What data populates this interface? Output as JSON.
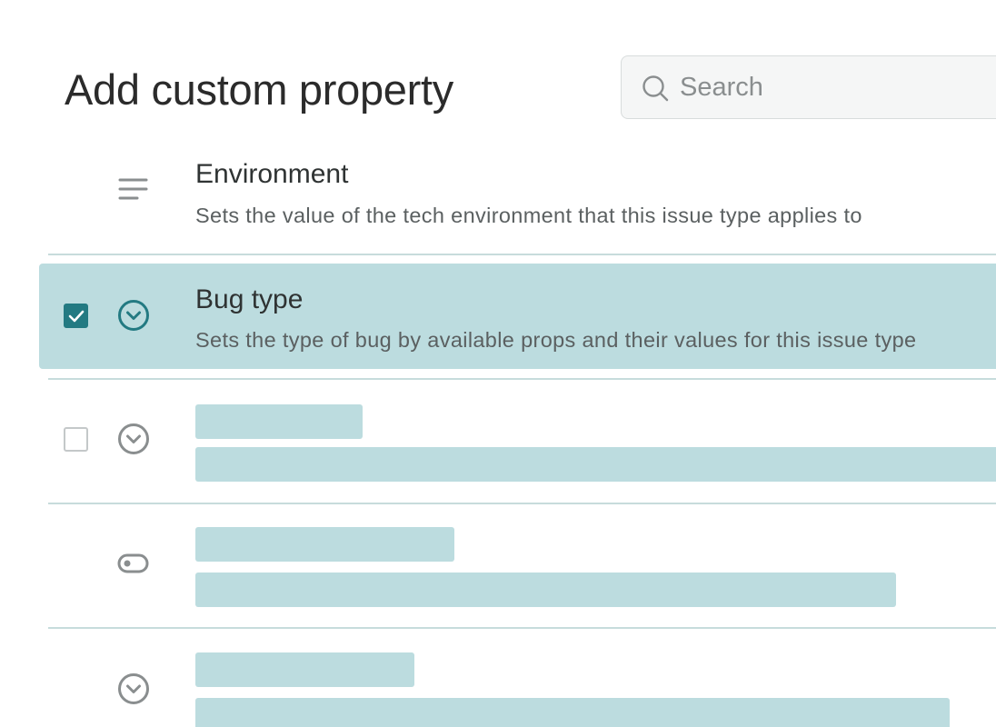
{
  "header": {
    "title": "Add custom property"
  },
  "search": {
    "placeholder": "Search",
    "value": "",
    "icon": "search-icon"
  },
  "properties": [
    {
      "title": "Environment",
      "description": "Sets the value of the tech environment that this issue type applies to",
      "icon": "text-lines-icon",
      "checkbox": "none",
      "selected": false
    },
    {
      "title": "Bug type",
      "description": "Sets the type of bug by available props and their values for this issue type",
      "icon": "chevron-down-circle-icon",
      "checkbox": "checked",
      "selected": true
    },
    {
      "title": "",
      "description": "",
      "icon": "chevron-down-circle-icon",
      "checkbox": "unchecked",
      "selected": false,
      "loading": true
    },
    {
      "title": "",
      "description": "",
      "icon": "toggle-icon",
      "checkbox": "none",
      "selected": false,
      "loading": true
    },
    {
      "title": "",
      "description": "",
      "icon": "chevron-down-circle-icon",
      "checkbox": "none",
      "selected": false,
      "loading": true
    }
  ],
  "colors": {
    "accent": "#237a82",
    "selected_row": "#bcdcdf",
    "skeleton": "#bcdcdf",
    "divider": "#c7dcdc",
    "icon_gray": "#8a8e8f"
  }
}
